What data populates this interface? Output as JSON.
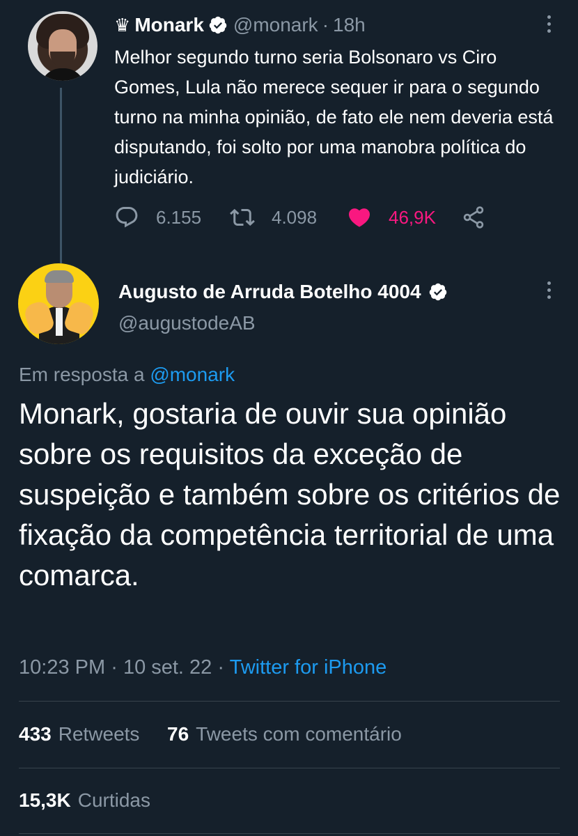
{
  "parent": {
    "crown": "♛",
    "name": "Monark",
    "handle": "@monark",
    "separator": "·",
    "time": "18h",
    "text": "Melhor segundo turno seria Bolsonaro vs Ciro Gomes, Lula não merece sequer ir para o segundo turno na minha opinião, de fato ele nem deveria está disputando, foi solto por uma manobra política do judiciário.",
    "replies": "6.155",
    "retweets": "4.098",
    "likes": "46,9K",
    "liked": true
  },
  "tweet": {
    "name": "Augusto de Arruda Botelho 4004",
    "handle": "@augustodeAB",
    "reply_prefix": "Em resposta a",
    "reply_handle": "@monark",
    "text": "Monark, gostaria de ouvir sua opinião sobre os requisitos da exceção de suspeição e também sobre os critérios  de fixação da competência territorial de uma comarca.",
    "time": "10:23 PM",
    "separator": "·",
    "date": "10 set. 22",
    "source": "Twitter for iPhone"
  },
  "stats": {
    "retweets_count": "433",
    "retweets_label": "Retweets",
    "quotes_count": "76",
    "quotes_label": "Tweets com comentário",
    "likes_count": "15,3K",
    "likes_label": "Curtidas"
  },
  "colors": {
    "background": "#15202b",
    "text": "#ffffff",
    "muted": "#8b98a5",
    "link": "#1d9bf0",
    "like": "#f91880",
    "divider": "#38444d"
  },
  "icons": [
    "crown-icon",
    "verified-badge-icon",
    "more-options-icon",
    "reply-icon",
    "retweet-icon",
    "heart-icon",
    "share-icon"
  ]
}
